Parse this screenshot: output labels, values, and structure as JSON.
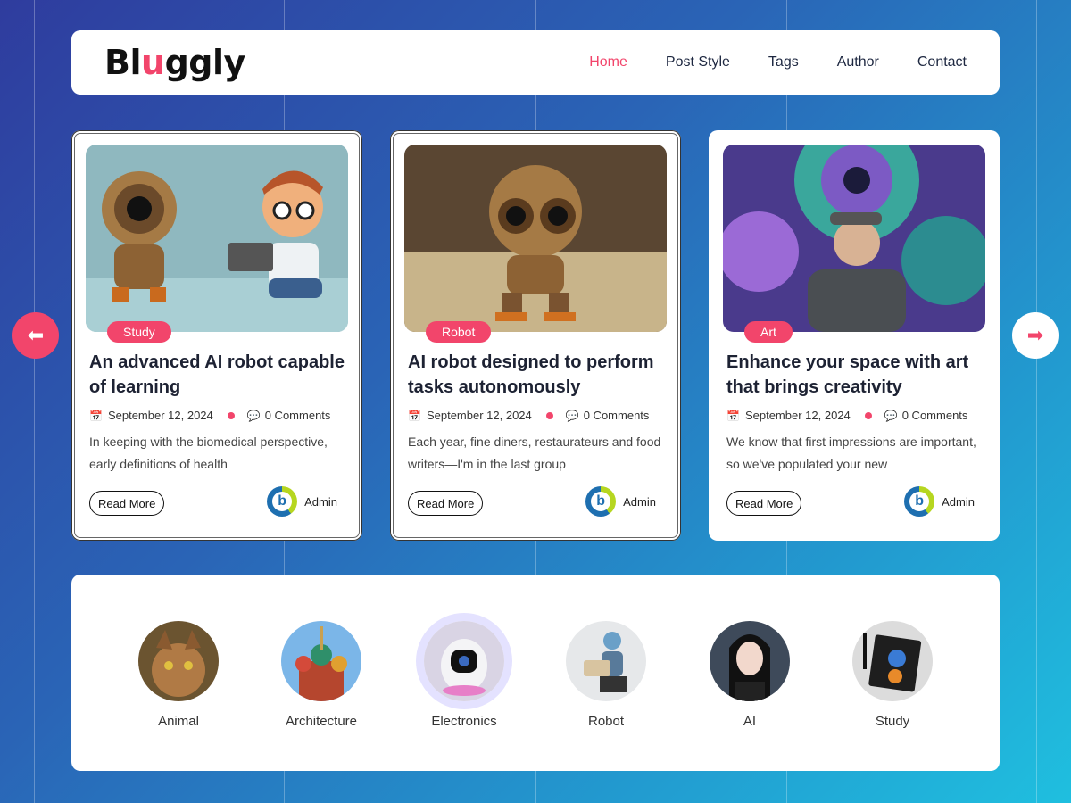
{
  "header": {
    "logo_text": [
      "Bl",
      "u",
      "ggly"
    ],
    "nav": [
      {
        "label": "Home",
        "active": true
      },
      {
        "label": "Post Style",
        "active": false
      },
      {
        "label": "Tags",
        "active": false
      },
      {
        "label": "Author",
        "active": false
      },
      {
        "label": "Contact",
        "active": false
      }
    ]
  },
  "posts": [
    {
      "tag": "Study",
      "title": "An advanced AI robot capable of learning",
      "date": "September 12, 2024",
      "comments": "0 Comments",
      "excerpt": "In keeping with the biomedical perspective, early definitions of health",
      "read_more": "Read More",
      "author": "Admin"
    },
    {
      "tag": "Robot",
      "title": "AI robot designed to perform tasks autonomously",
      "date": "September 12, 2024",
      "comments": "0 Comments",
      "excerpt": "Each year, fine diners, restaurateurs and food writers—I'm in the last group",
      "read_more": "Read More",
      "author": "Admin"
    },
    {
      "tag": "Art",
      "title": "Enhance your space with art that brings creativity",
      "date": "September 12, 2024",
      "comments": "0 Comments",
      "excerpt": "We know that first impressions are important, so we've populated your new",
      "read_more": "Read More",
      "author": "Admin"
    }
  ],
  "categories": [
    {
      "label": "Animal"
    },
    {
      "label": "Architecture"
    },
    {
      "label": "Electronics"
    },
    {
      "label": "Robot"
    },
    {
      "label": "AI"
    },
    {
      "label": "Study"
    }
  ],
  "colors": {
    "accent": "#f2456b",
    "text_dark": "#1d2233"
  },
  "icons": {
    "prev": "arrow-left-icon",
    "next": "arrow-right-icon",
    "date": "calendar-icon",
    "comments": "comment-icon"
  }
}
